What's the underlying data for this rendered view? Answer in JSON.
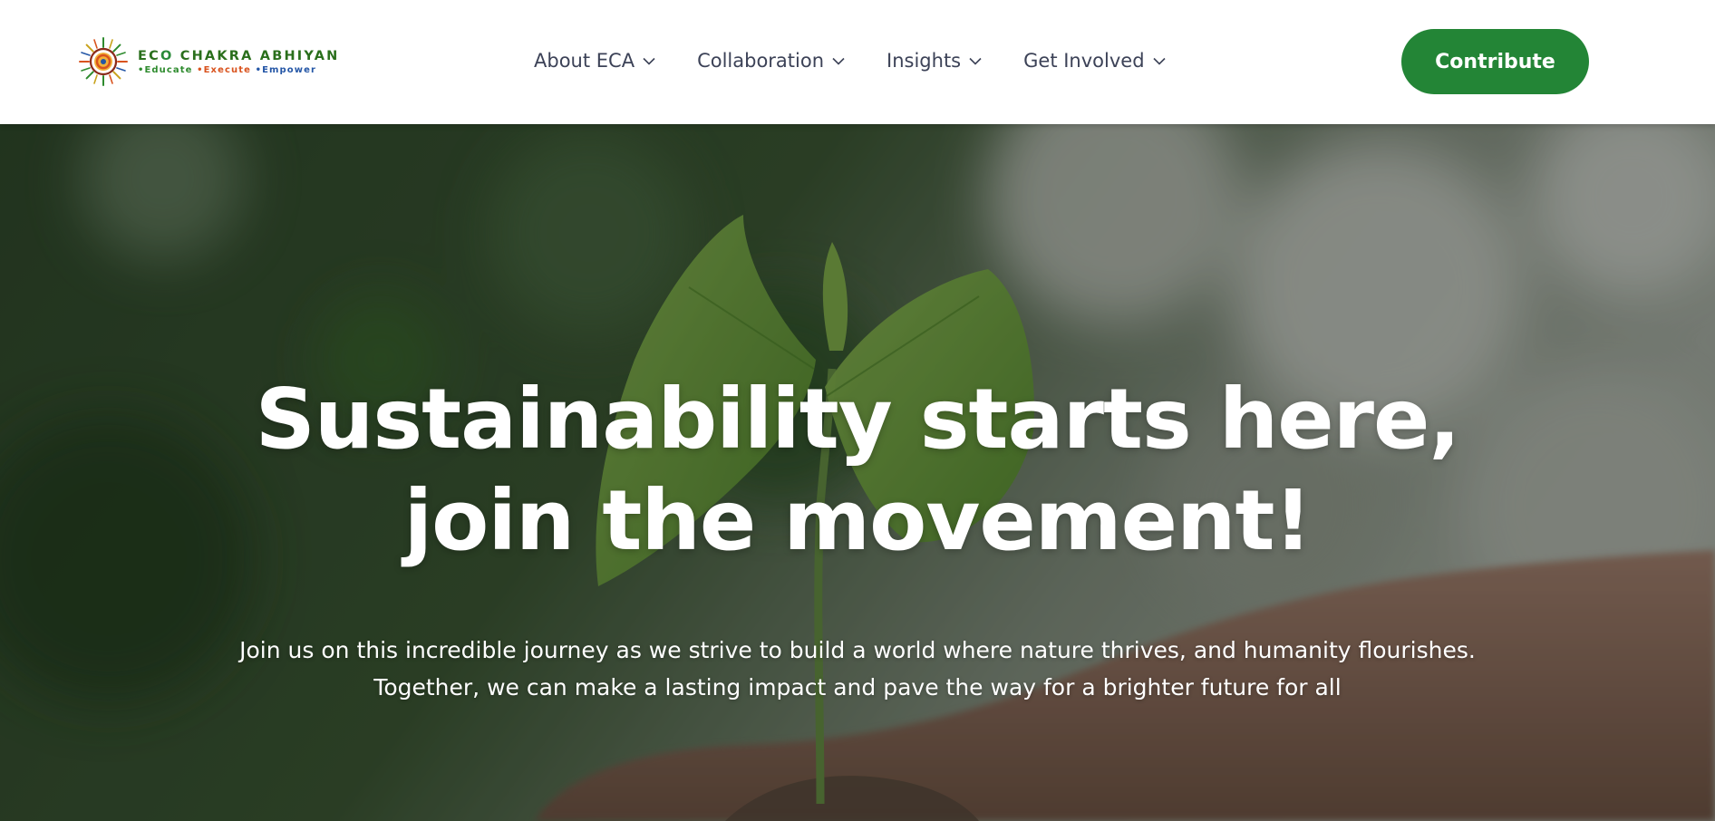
{
  "brand": {
    "name_prefix": "EC",
    "name_o": "O",
    "name_rest": " CHAKRA ABHIYAN",
    "tagline": [
      "•Educate ",
      "•Execute ",
      "•Empower"
    ],
    "colors": {
      "green": "#2a6f1c",
      "orange": "#d9531e",
      "blue": "#2456a6"
    }
  },
  "nav": {
    "items": [
      {
        "label": "About ECA",
        "icon": "chevron-down-icon"
      },
      {
        "label": "Collaboration",
        "icon": "chevron-down-icon"
      },
      {
        "label": "Insights",
        "icon": "chevron-down-icon"
      },
      {
        "label": "Get Involved",
        "icon": "chevron-down-icon"
      }
    ]
  },
  "header": {
    "contribute_label": "Contribute",
    "accent": "#238536"
  },
  "hero": {
    "headline_line1": "Sustainability starts here,",
    "headline_line2": "join the movement!",
    "subtext_line1": "Join us on this incredible journey as we strive to build a world where nature thrives, and humanity flourishes.",
    "subtext_line2": "Together, we can make a lasting impact and pave the way for a brighter future for all"
  }
}
